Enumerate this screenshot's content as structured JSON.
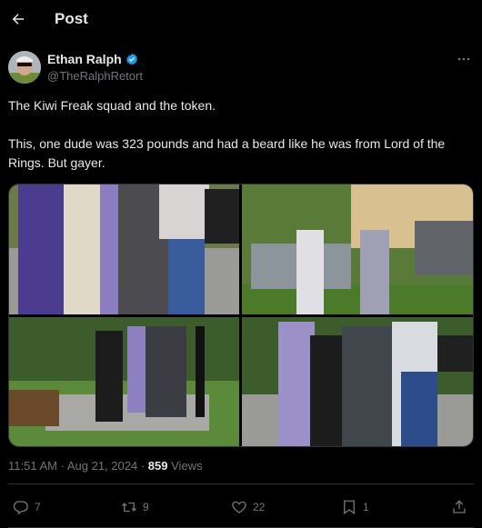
{
  "header": {
    "title": "Post"
  },
  "author": {
    "name": "Ethan Ralph",
    "handle": "@TheRalphRetort"
  },
  "tweet": {
    "paragraphs": [
      "The Kiwi Freak squad and the token.",
      "This, one dude was 323 pounds and had a beard like he was from Lord of the Rings. But gayer."
    ]
  },
  "meta": {
    "time": "11:51 AM",
    "date": "Aug 21, 2024",
    "separator": "·",
    "views_count": "859",
    "views_label": "Views"
  },
  "actions": {
    "replies": "7",
    "reposts": "9",
    "likes": "22",
    "bookmarks": "1"
  },
  "colors": {
    "background": "#000000",
    "text": "#e7e9ea",
    "muted": "#71767b",
    "verified": "#1d9bf0",
    "divider": "#2f3336"
  },
  "icons": [
    "back-arrow-icon",
    "verified-badge-icon",
    "more-options-icon",
    "reply-icon",
    "repost-icon",
    "like-icon",
    "bookmark-icon",
    "share-icon"
  ]
}
